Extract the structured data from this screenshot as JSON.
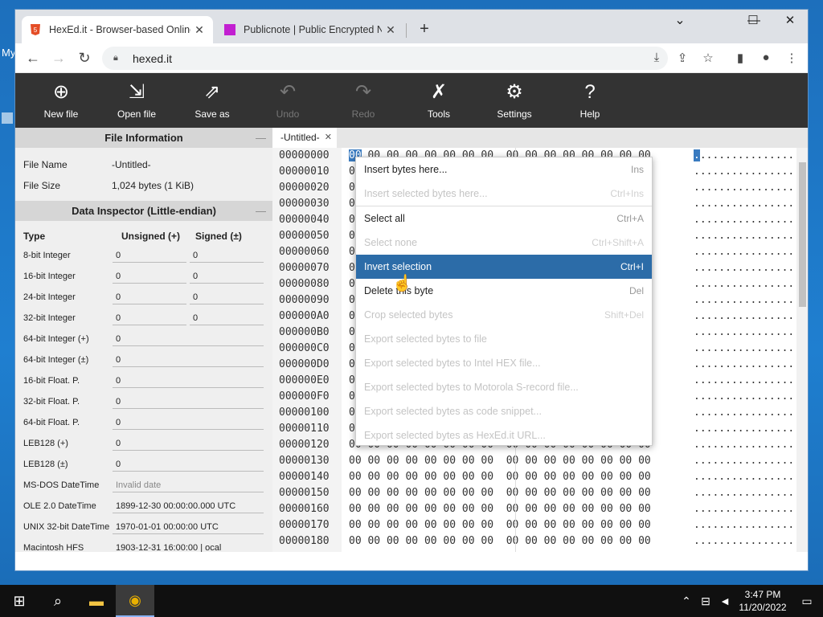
{
  "desktop": {
    "label": "My"
  },
  "browser": {
    "tabs": [
      {
        "title": "HexEd.it - Browser-based Online",
        "close": "✕"
      },
      {
        "title": "Publicnote | Public Encrypted No",
        "close": "✕"
      }
    ],
    "new_tab": "+",
    "url": "hexed.it"
  },
  "app_toolbar": {
    "buttons": [
      {
        "label": "New file",
        "icon": "⊕"
      },
      {
        "label": "Open file",
        "icon": "⇲"
      },
      {
        "label": "Save as",
        "icon": "⇗"
      },
      {
        "label": "Undo",
        "icon": "↶"
      },
      {
        "label": "Redo",
        "icon": "↷"
      },
      {
        "label": "Tools",
        "icon": "✗"
      },
      {
        "label": "Settings",
        "icon": "⚙"
      },
      {
        "label": "Help",
        "icon": "?"
      }
    ]
  },
  "file_info": {
    "heading": "File Information",
    "rows": [
      {
        "key": "File Name",
        "value": "-Untitled-"
      },
      {
        "key": "File Size",
        "value": "1,024 bytes (1 KiB)"
      }
    ]
  },
  "data_inspector": {
    "heading": "Data Inspector (Little-endian)",
    "col_type": "Type",
    "col_unsigned": "Unsigned (+)",
    "col_signed": "Signed (±)",
    "rows_pair": [
      {
        "type": "8-bit Integer",
        "u": "0",
        "s": "0"
      },
      {
        "type": "16-bit Integer",
        "u": "0",
        "s": "0"
      },
      {
        "type": "24-bit Integer",
        "u": "0",
        "s": "0"
      },
      {
        "type": "32-bit Integer",
        "u": "0",
        "s": "0"
      }
    ],
    "rows_single": [
      {
        "type": "64-bit Integer (+)",
        "v": "0"
      },
      {
        "type": "64-bit Integer (±)",
        "v": "0"
      },
      {
        "type": "16-bit Float. P.",
        "v": "0"
      },
      {
        "type": "32-bit Float. P.",
        "v": "0"
      },
      {
        "type": "64-bit Float. P.",
        "v": "0"
      },
      {
        "type": "LEB128 (+)",
        "v": "0"
      },
      {
        "type": "LEB128 (±)",
        "v": "0"
      },
      {
        "type": "MS-DOS DateTime",
        "v": "Invalid date"
      },
      {
        "type": "OLE 2.0 DateTime",
        "v": "1899-12-30 00:00:00.000 UTC"
      },
      {
        "type": "UNIX 32-bit DateTime",
        "v": "1970-01-01 00:00:00 UTC"
      },
      {
        "type": "Macintosh HFS",
        "v": "1903-12-31 16:00:00 | ocal"
      }
    ]
  },
  "file_tab": {
    "name": "-Untitled-",
    "close": "✕"
  },
  "hex": {
    "offsets": [
      "00000000",
      "00000010",
      "00000020",
      "00000030",
      "00000040",
      "00000050",
      "00000060",
      "00000070",
      "00000080",
      "00000090",
      "000000A0",
      "000000B0",
      "000000C0",
      "000000D0",
      "000000E0",
      "000000F0",
      "00000100",
      "00000110",
      "00000120",
      "00000130",
      "00000140",
      "00000150",
      "00000160",
      "00000170",
      "00000180"
    ],
    "byte": "00",
    "ascii_row": "................"
  },
  "context_menu": {
    "items": [
      {
        "label": "Insert bytes here...",
        "shortcut": "Ins",
        "state": "normal"
      },
      {
        "label": "Insert selected bytes here...",
        "shortcut": "Ctrl+Ins",
        "state": "disabled"
      },
      {
        "sep": true
      },
      {
        "label": "Select all",
        "shortcut": "Ctrl+A",
        "state": "normal"
      },
      {
        "label": "Select none",
        "shortcut": "Ctrl+Shift+A",
        "state": "disabled"
      },
      {
        "label": "Invert selection",
        "shortcut": "Ctrl+I",
        "state": "active"
      },
      {
        "label": "Delete this byte",
        "shortcut": "Del",
        "state": "normal"
      },
      {
        "label": "Crop selected bytes",
        "shortcut": "Shift+Del",
        "state": "disabled"
      },
      {
        "label": "Export selected bytes to file",
        "shortcut": "",
        "state": "disabled"
      },
      {
        "label": "Export selected bytes to Intel HEX file...",
        "shortcut": "",
        "state": "disabled"
      },
      {
        "label": "Export selected bytes to Motorola S-record file...",
        "shortcut": "",
        "state": "disabled"
      },
      {
        "label": "Export selected bytes as code snippet...",
        "shortcut": "",
        "state": "disabled"
      },
      {
        "label": "Export selected bytes as HexEd.it URL...",
        "shortcut": "",
        "state": "disabled"
      }
    ]
  },
  "taskbar": {
    "time": "3:47 PM",
    "date": "11/20/2022"
  }
}
